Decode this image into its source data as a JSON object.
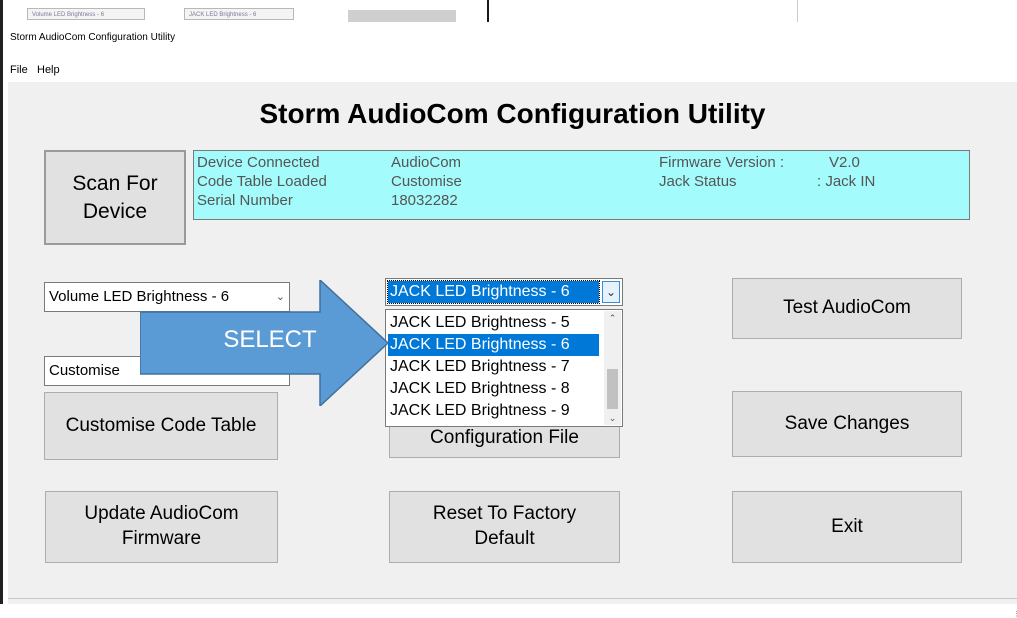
{
  "backdrop": {
    "tabs": [
      "Volume LED Brightness - 6",
      "JACK LED Brightness - 6"
    ]
  },
  "window": {
    "title": "Storm AudioCom  Configuration Utility",
    "menu": [
      "File",
      "Help"
    ],
    "heading": "Storm AudioCom  Configuration Utility"
  },
  "scan_button": {
    "line1": "Scan For",
    "line2": "Device"
  },
  "info": {
    "device_connected_label": "Device Connected",
    "device_connected_value": "AudioCom",
    "code_table_label": "Code Table Loaded",
    "code_table_value": "Customise",
    "serial_label": "Serial Number",
    "serial_value": "18032282",
    "firmware_label": "Firmware Version  :",
    "firmware_value": "V2.0",
    "jack_label": "Jack Status",
    "jack_value": ":  Jack  IN"
  },
  "volume_combo": {
    "value": "Volume LED Brightness - 6",
    "arrow": "chevron-down"
  },
  "code_table_combo": {
    "value": "Customise"
  },
  "jack_combo": {
    "value": "JACK LED Brightness - 6",
    "options": [
      "JACK LED Brightness - 5",
      "JACK LED Brightness - 6",
      "JACK LED Brightness - 7",
      "JACK LED Brightness - 8",
      "JACK LED Brightness - 9"
    ],
    "selected_index": 1
  },
  "annotation": {
    "text": "SELECT",
    "color": "#5b9bd5"
  },
  "buttons": {
    "test": "Test AudioCom",
    "customise": "Customise Code Table",
    "config_file": "Configuration File",
    "save": "Save Changes",
    "update_line1": "Update AudioCom",
    "update_line2": "Firmware",
    "reset_line1": "Reset To Factory",
    "reset_line2": "Default",
    "exit": "Exit"
  },
  "colors": {
    "info_panel": "#a4fbfb",
    "selection": "#0078d7",
    "button_face": "#e1e1e1"
  }
}
